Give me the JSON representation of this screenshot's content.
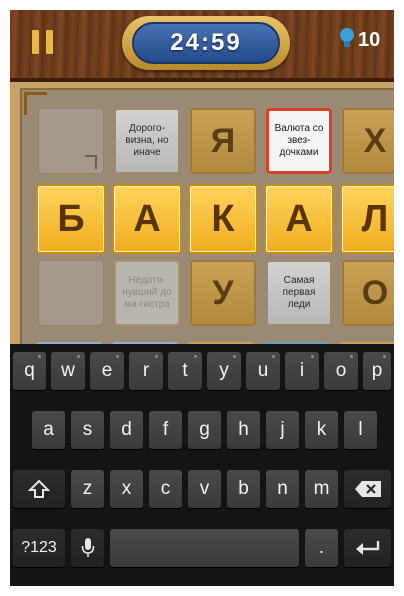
{
  "timer": "24:59",
  "hints": {
    "count": "10"
  },
  "board": {
    "row1": {
      "clue_a": "Дорого-визна, но иначе",
      "letter_a": "Я",
      "clue_b": "Валюта со звез-дочками",
      "letter_b": "Х"
    },
    "row2": {
      "letters": [
        "Б",
        "А",
        "К",
        "А",
        "Л"
      ]
    },
    "row3": {
      "clue_a": "Недотя-нувший до ма-гистра",
      "letter_a": "У",
      "clue_b": "Самая первая леди",
      "letter_b": "О"
    }
  },
  "keyboard": {
    "row1": [
      "q",
      "w",
      "e",
      "r",
      "t",
      "y",
      "u",
      "i",
      "o",
      "p"
    ],
    "row2": [
      "a",
      "s",
      "d",
      "f",
      "g",
      "h",
      "j",
      "k",
      "l"
    ],
    "row3": [
      "z",
      "x",
      "c",
      "v",
      "b",
      "n",
      "m"
    ],
    "symbols": "?123",
    "period": "."
  },
  "colors": {
    "letter_bright": "#f0ad1e",
    "selected_border": "#d8412a",
    "timer_blue": "#2f5ea3"
  }
}
